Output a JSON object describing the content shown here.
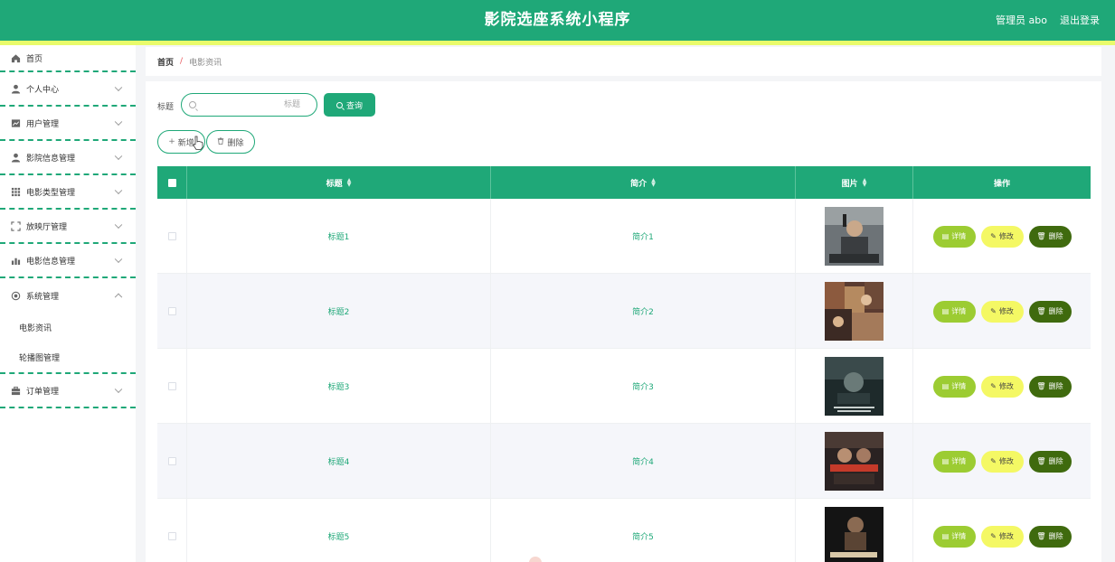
{
  "header": {
    "title": "影院选座系统小程序",
    "admin": "管理员 abo",
    "logout": "退出登录",
    "color": "#1fa878",
    "stripe_color": "#e9fb6b"
  },
  "sidebar": {
    "items": [
      {
        "label": "首页",
        "icon": "home-icon"
      },
      {
        "label": "个人中心",
        "icon": "user-icon"
      },
      {
        "label": "用户管理",
        "icon": "chart-icon"
      },
      {
        "label": "影院信息管理",
        "icon": "user-icon"
      },
      {
        "label": "电影类型管理",
        "icon": "grid-icon"
      },
      {
        "label": "放映厅管理",
        "icon": "fullscreen-icon"
      },
      {
        "label": "电影信息管理",
        "icon": "bar-chart-icon"
      },
      {
        "label": "系统管理",
        "icon": "settings-icon"
      },
      {
        "label": "订单管理",
        "icon": "briefcase-icon"
      }
    ],
    "sub_items": [
      "电影资讯",
      "轮播图管理"
    ]
  },
  "breadcrumb": {
    "home": "首页",
    "separator": "/",
    "current": "电影资讯"
  },
  "search": {
    "label": "标题",
    "placeholder": "标题",
    "query_button": "查询"
  },
  "actions": {
    "add": "新增",
    "delete": "删除"
  },
  "table": {
    "columns": [
      "标题",
      "简介",
      "图片",
      "操作"
    ],
    "rows": [
      {
        "title": "标题1",
        "intro": "简介1"
      },
      {
        "title": "标题2",
        "intro": "简介2"
      },
      {
        "title": "标题3",
        "intro": "简介3"
      },
      {
        "title": "标题4",
        "intro": "简介4"
      },
      {
        "title": "标题5",
        "intro": "简介5"
      }
    ],
    "row_actions": {
      "detail": "详情",
      "edit": "修改",
      "delete": "删除"
    }
  }
}
